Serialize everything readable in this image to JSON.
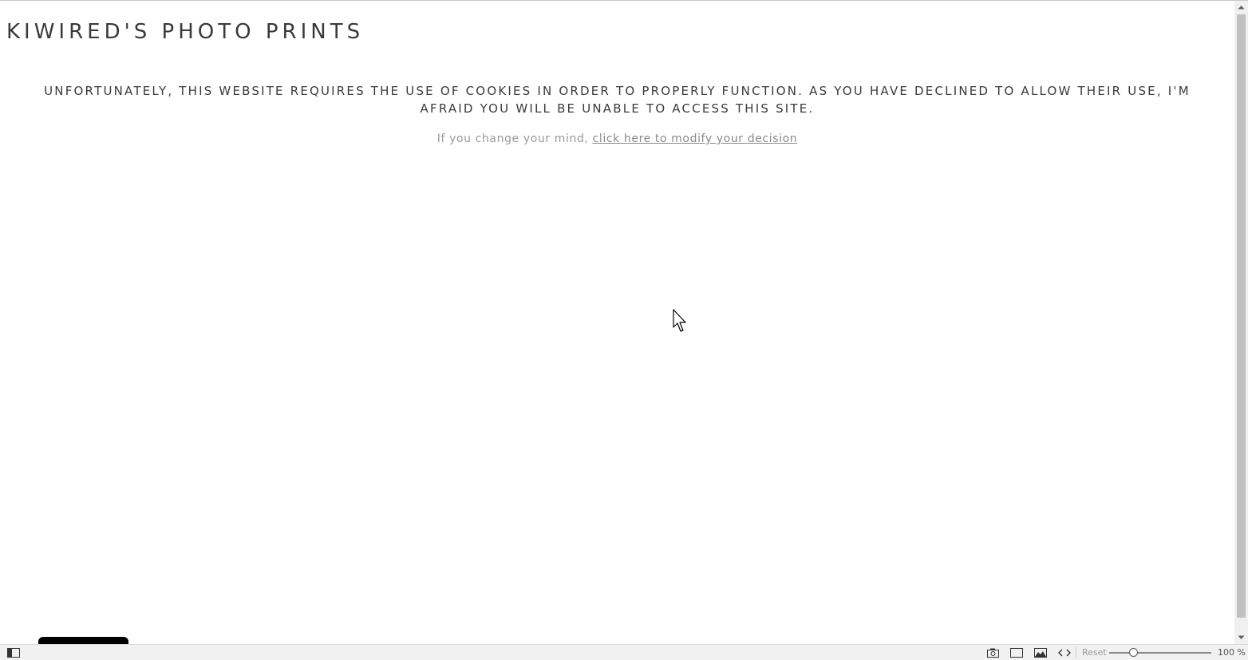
{
  "site": {
    "title": "KIWIRED'S PHOTO PRINTS"
  },
  "cookie_notice": {
    "message": "UNFORTUNATELY, THIS WEBSITE REQUIRES THE USE OF COOKIES IN ORDER TO PROPERLY FUNCTION. AS YOU HAVE DECLINED TO ALLOW THEIR USE, I'M AFRAID YOU WILL BE UNABLE TO ACCESS THIS SITE.",
    "change_prefix": "If you change your mind, ",
    "change_link": "click here to modify your decision"
  },
  "status_bar": {
    "reset_label": "Reset",
    "zoom_level": 1.0,
    "zoom_text": "100 %",
    "icons": [
      "panel-toggle-icon",
      "camera-icon",
      "window-icon",
      "image-icon",
      "code-icon"
    ]
  },
  "colors": {
    "text": "#3a3a3a",
    "muted": "#9a9a9a",
    "background": "#ffffff"
  }
}
